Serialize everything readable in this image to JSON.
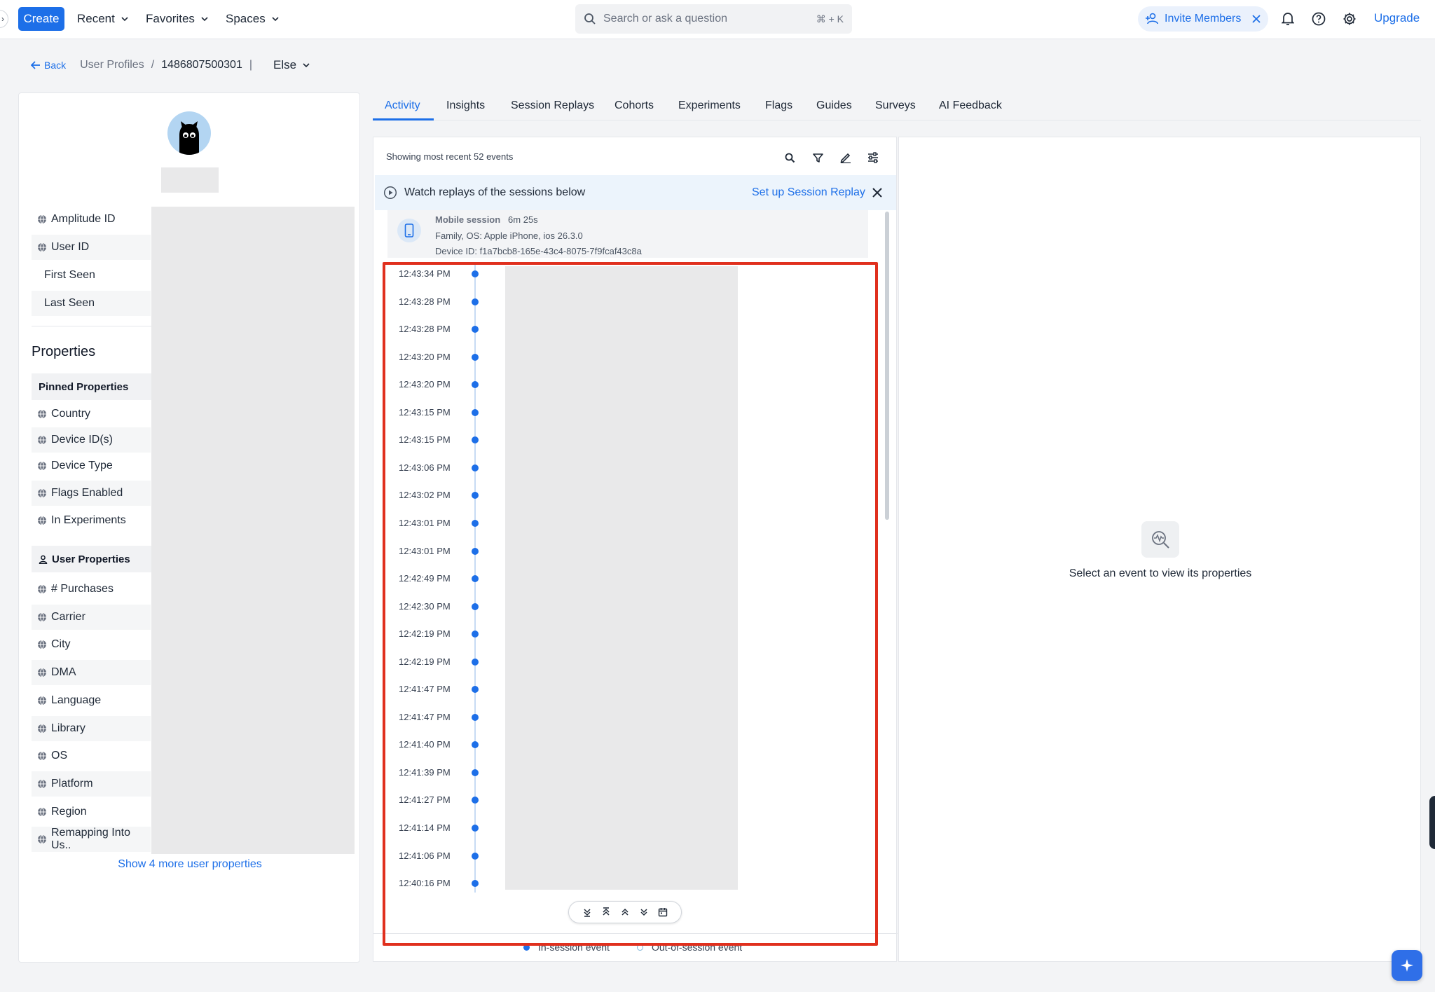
{
  "topnav": {
    "create_label": "Create",
    "menus": [
      "Recent",
      "Favorites",
      "Spaces"
    ],
    "search_placeholder": "Search or ask a question",
    "search_shortcut": "⌘ + K",
    "invite_label": "Invite Members",
    "upgrade_label": "Upgrade",
    "icons": [
      "bell-icon",
      "help-icon",
      "gear-icon"
    ]
  },
  "breadcrumb": {
    "back_label": "Back",
    "section": "User Profiles",
    "separator": "/",
    "user_id": "1486807500301",
    "pipe": "|",
    "project": "Else"
  },
  "profile": {
    "identity_rows": [
      {
        "label": "Amplitude ID",
        "icon": "globe-icon"
      },
      {
        "label": "User ID",
        "icon": "globe-icon"
      },
      {
        "label": "First Seen",
        "icon": ""
      },
      {
        "label": "Last Seen",
        "icon": ""
      }
    ],
    "properties_heading": "Properties",
    "pinned_heading": "Pinned Properties",
    "pinned": [
      "Country",
      "Device ID(s)",
      "Device Type",
      "Flags Enabled",
      "In Experiments"
    ],
    "user_props_heading": "User Properties",
    "user_props": [
      "# Purchases",
      "Carrier",
      "City",
      "DMA",
      "Language",
      "Library",
      "OS",
      "Platform",
      "Region",
      "Remapping Into Us.."
    ],
    "show_more_label": "Show 4 more user properties"
  },
  "tabs": [
    "Activity",
    "Insights",
    "Session Replays",
    "Cohorts",
    "Experiments",
    "Flags",
    "Guides",
    "Surveys",
    "AI Feedback"
  ],
  "active_tab": "Activity",
  "activity": {
    "header": "Showing most recent 52 events",
    "toolbar_icons": [
      "search-icon",
      "filter-icon",
      "edit-icon",
      "settings-sliders-icon"
    ],
    "banner_text": "Watch replays of the sessions below",
    "banner_link": "Set up Session Replay",
    "session": {
      "title": "Mobile session",
      "duration": "6m 25s",
      "device_line": "Family, OS: Apple iPhone, ios 26.3.0",
      "device_id_line": "Device ID: f1a7bcb8-165e-43c4-8075-7f9fcaf43c8a"
    },
    "events": [
      "12:43:34 PM",
      "12:43:28 PM",
      "12:43:28 PM",
      "12:43:20 PM",
      "12:43:20 PM",
      "12:43:15 PM",
      "12:43:15 PM",
      "12:43:06 PM",
      "12:43:02 PM",
      "12:43:01 PM",
      "12:43:01 PM",
      "12:42:49 PM",
      "12:42:30 PM",
      "12:42:19 PM",
      "12:42:19 PM",
      "12:41:47 PM",
      "12:41:47 PM",
      "12:41:40 PM",
      "12:41:39 PM",
      "12:41:27 PM",
      "12:41:14 PM",
      "12:41:06 PM",
      "12:40:16 PM"
    ],
    "legend": {
      "in_session": "In-session event",
      "out_session": "Out-of-session event"
    },
    "colors": {
      "accent": "#1d6fe8",
      "highlight_box": "#e0301e"
    }
  },
  "details": {
    "empty_text": "Select an event to view its properties"
  }
}
